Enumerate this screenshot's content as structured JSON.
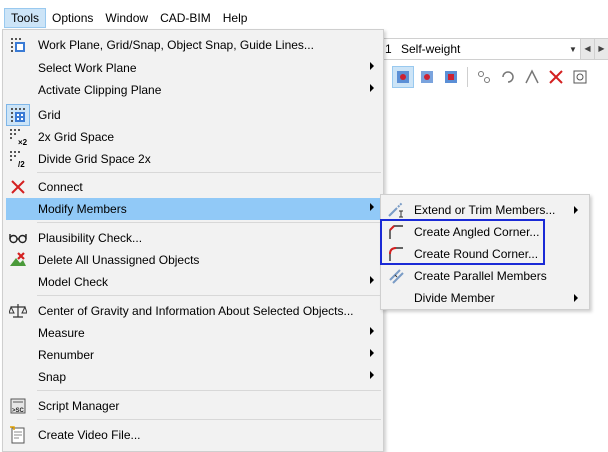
{
  "menubar": {
    "items": [
      "Tools",
      "Options",
      "Window",
      "CAD-BIM",
      "Help"
    ],
    "active": "Tools"
  },
  "loadcase": {
    "number": "1",
    "name": "Self-weight"
  },
  "tools_menu": {
    "items": [
      {
        "label": "Work Plane, Grid/Snap, Object Snap, Guide Lines...",
        "icon": "work-plane-icon",
        "submenu": false
      },
      {
        "label": "Select Work Plane",
        "icon": "",
        "submenu": true
      },
      {
        "label": "Activate Clipping Plane",
        "icon": "",
        "submenu": true
      },
      {
        "label": "Grid",
        "icon": "grid-icon",
        "submenu": false,
        "checked": true
      },
      {
        "label": "2x Grid Space",
        "icon": "grid-double-icon",
        "submenu": false
      },
      {
        "label": "Divide Grid Space 2x",
        "icon": "grid-half-icon",
        "submenu": false
      },
      {
        "label": "Connect",
        "icon": "connect-icon",
        "submenu": false
      },
      {
        "label": "Modify Members",
        "icon": "",
        "submenu": true,
        "highlighted": true
      },
      {
        "label": "Plausibility Check...",
        "icon": "glasses-icon",
        "submenu": false
      },
      {
        "label": "Delete All Unassigned Objects",
        "icon": "delete-objects-icon",
        "submenu": false
      },
      {
        "label": "Model Check",
        "icon": "",
        "submenu": true
      },
      {
        "label": "Center of Gravity and Information About Selected Objects...",
        "icon": "scale-icon",
        "submenu": false
      },
      {
        "label": "Measure",
        "icon": "",
        "submenu": true
      },
      {
        "label": "Renumber",
        "icon": "",
        "submenu": true
      },
      {
        "label": "Snap",
        "icon": "",
        "submenu": true
      },
      {
        "label": "Script Manager",
        "icon": "script-icon",
        "submenu": false
      },
      {
        "label": "Create Video File...",
        "icon": "video-icon",
        "submenu": false
      }
    ]
  },
  "modify_members_submenu": {
    "items": [
      {
        "label": "Extend or Trim Members...",
        "icon": "extend-trim-icon",
        "submenu": true
      },
      {
        "label": "Create Angled Corner...",
        "icon": "angled-corner-icon",
        "submenu": false
      },
      {
        "label": "Create Round Corner...",
        "icon": "round-corner-icon",
        "submenu": false
      },
      {
        "label": "Create Parallel Members",
        "icon": "parallel-members-icon",
        "submenu": false
      },
      {
        "label": "Divide Member",
        "icon": "",
        "submenu": true
      }
    ]
  },
  "colors": {
    "menu_bg": "#f2f2f2",
    "highlight": "#91c9f7",
    "active_menubar": "#cce4f7",
    "callout_border": "#1a2ad6",
    "connect_red": "#d42020"
  }
}
